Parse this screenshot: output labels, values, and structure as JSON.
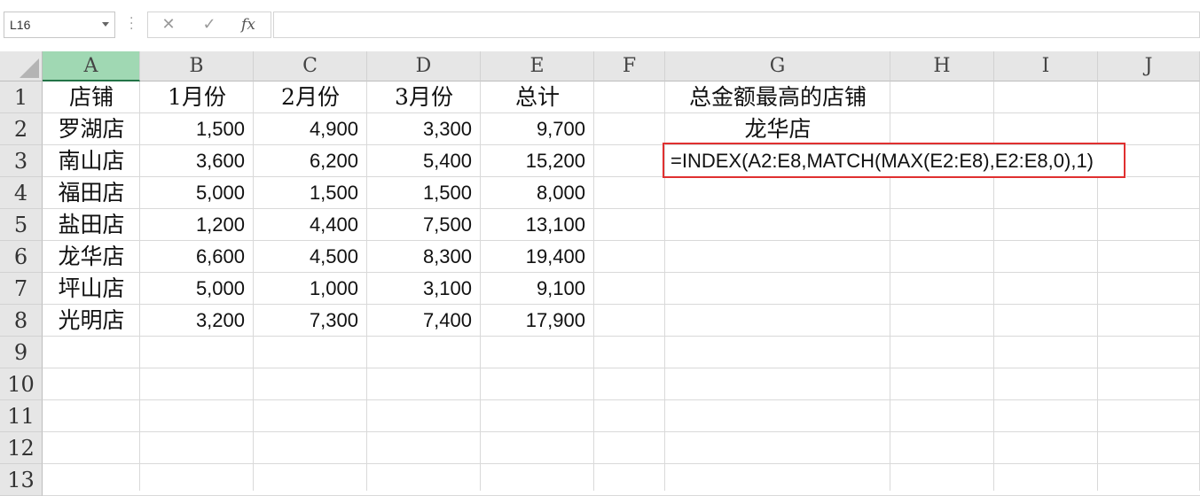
{
  "formula_bar": {
    "name_box": "L16",
    "cancel_icon": "✕",
    "enter_icon": "✓",
    "fx_label": "fx",
    "formula_value": ""
  },
  "columns": [
    "A",
    "B",
    "C",
    "D",
    "E",
    "F",
    "G",
    "H",
    "I",
    "J"
  ],
  "selected_column": "A",
  "rows": [
    "1",
    "2",
    "3",
    "4",
    "5",
    "6",
    "7",
    "8",
    "9",
    "10",
    "11",
    "12",
    "13"
  ],
  "table": {
    "headers": [
      "店铺",
      "1月份",
      "2月份",
      "3月份",
      "总计"
    ],
    "data": [
      [
        "罗湖店",
        "1,500",
        "4,900",
        "3,300",
        "9,700"
      ],
      [
        "南山店",
        "3,600",
        "6,200",
        "5,400",
        "15,200"
      ],
      [
        "福田店",
        "5,000",
        "1,500",
        "1,500",
        "8,000"
      ],
      [
        "盐田店",
        "1,200",
        "4,400",
        "7,500",
        "13,100"
      ],
      [
        "龙华店",
        "6,600",
        "4,500",
        "8,300",
        "19,400"
      ],
      [
        "坪山店",
        "5,000",
        "1,000",
        "3,100",
        "9,100"
      ],
      [
        "光明店",
        "3,200",
        "7,300",
        "7,400",
        "17,900"
      ]
    ]
  },
  "lookup": {
    "title": "总金额最高的店铺",
    "result": "龙华店",
    "formula": "=INDEX(A2:E8,MATCH(MAX(E2:E8),E2:E8,0),1)"
  },
  "colors": {
    "highlight_border": "#e03030",
    "selected_header": "#a0d8b3",
    "header_bg": "#e6e6e6"
  }
}
